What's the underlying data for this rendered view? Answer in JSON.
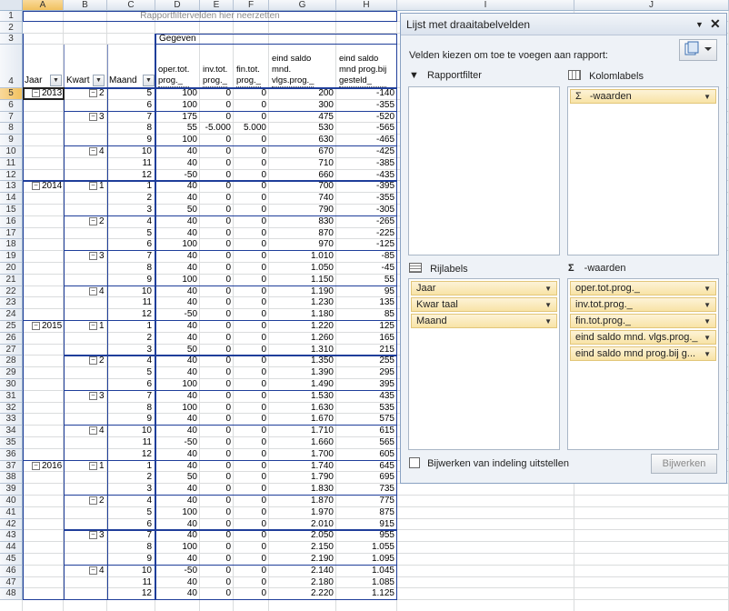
{
  "sheet": {
    "col_headers": [
      "A",
      "B",
      "C",
      "D",
      "E",
      "F",
      "G",
      "H",
      "I",
      "J"
    ],
    "row_numbers": [
      "1",
      "2",
      "3",
      "4",
      "5",
      "6",
      "7",
      "8",
      "9",
      "10",
      "11",
      "12",
      "13",
      "14",
      "15",
      "16",
      "17",
      "18",
      "19",
      "20",
      "21",
      "22",
      "23",
      "24",
      "25",
      "26",
      "27",
      "28",
      "29",
      "30",
      "31",
      "32",
      "33",
      "34",
      "35",
      "36",
      "37",
      "38",
      "39",
      "40",
      "41",
      "42",
      "43",
      "44",
      "45",
      "46",
      "47",
      "48"
    ],
    "report_filter_drop": "Rapportfiltervelden hier neerzetten",
    "data_label": "Gegeven",
    "row_field_headers": [
      "Jaar",
      "Kwart",
      "Maand"
    ],
    "value_headers": [
      "oper.tot.\nprog._",
      "inv.tot.\nprog._",
      "fin.tot.\nprog._",
      "eind saldo\nmnd.\nvlgs.prog._",
      "eind saldo\nmnd prog.bij\ngesteld_"
    ],
    "rows": [
      {
        "jaar": "2013",
        "kwart": "2",
        "maand": "5",
        "d": "100",
        "e": "0",
        "f": "0",
        "g": "200",
        "h": "-140"
      },
      {
        "jaar": "",
        "kwart": "",
        "maand": "6",
        "d": "100",
        "e": "0",
        "f": "0",
        "g": "300",
        "h": "-355"
      },
      {
        "jaar": "",
        "kwart": "3",
        "maand": "7",
        "d": "175",
        "e": "0",
        "f": "0",
        "g": "475",
        "h": "-520"
      },
      {
        "jaar": "",
        "kwart": "",
        "maand": "8",
        "d": "55",
        "e": "-5.000",
        "f": "5.000",
        "g": "530",
        "h": "-565"
      },
      {
        "jaar": "",
        "kwart": "",
        "maand": "9",
        "d": "100",
        "e": "0",
        "f": "0",
        "g": "630",
        "h": "-465"
      },
      {
        "jaar": "",
        "kwart": "4",
        "maand": "10",
        "d": "40",
        "e": "0",
        "f": "0",
        "g": "670",
        "h": "-425"
      },
      {
        "jaar": "",
        "kwart": "",
        "maand": "11",
        "d": "40",
        "e": "0",
        "f": "0",
        "g": "710",
        "h": "-385"
      },
      {
        "jaar": "",
        "kwart": "",
        "maand": "12",
        "d": "-50",
        "e": "0",
        "f": "0",
        "g": "660",
        "h": "-435"
      },
      {
        "jaar": "2014",
        "kwart": "1",
        "maand": "1",
        "d": "40",
        "e": "0",
        "f": "0",
        "g": "700",
        "h": "-395"
      },
      {
        "jaar": "",
        "kwart": "",
        "maand": "2",
        "d": "40",
        "e": "0",
        "f": "0",
        "g": "740",
        "h": "-355"
      },
      {
        "jaar": "",
        "kwart": "",
        "maand": "3",
        "d": "50",
        "e": "0",
        "f": "0",
        "g": "790",
        "h": "-305"
      },
      {
        "jaar": "",
        "kwart": "2",
        "maand": "4",
        "d": "40",
        "e": "0",
        "f": "0",
        "g": "830",
        "h": "-265"
      },
      {
        "jaar": "",
        "kwart": "",
        "maand": "5",
        "d": "40",
        "e": "0",
        "f": "0",
        "g": "870",
        "h": "-225"
      },
      {
        "jaar": "",
        "kwart": "",
        "maand": "6",
        "d": "100",
        "e": "0",
        "f": "0",
        "g": "970",
        "h": "-125"
      },
      {
        "jaar": "",
        "kwart": "3",
        "maand": "7",
        "d": "40",
        "e": "0",
        "f": "0",
        "g": "1.010",
        "h": "-85"
      },
      {
        "jaar": "",
        "kwart": "",
        "maand": "8",
        "d": "40",
        "e": "0",
        "f": "0",
        "g": "1.050",
        "h": "-45"
      },
      {
        "jaar": "",
        "kwart": "",
        "maand": "9",
        "d": "100",
        "e": "0",
        "f": "0",
        "g": "1.150",
        "h": "55"
      },
      {
        "jaar": "",
        "kwart": "4",
        "maand": "10",
        "d": "40",
        "e": "0",
        "f": "0",
        "g": "1.190",
        "h": "95"
      },
      {
        "jaar": "",
        "kwart": "",
        "maand": "11",
        "d": "40",
        "e": "0",
        "f": "0",
        "g": "1.230",
        "h": "135"
      },
      {
        "jaar": "",
        "kwart": "",
        "maand": "12",
        "d": "-50",
        "e": "0",
        "f": "0",
        "g": "1.180",
        "h": "85"
      },
      {
        "jaar": "2015",
        "kwart": "1",
        "maand": "1",
        "d": "40",
        "e": "0",
        "f": "0",
        "g": "1.220",
        "h": "125"
      },
      {
        "jaar": "",
        "kwart": "",
        "maand": "2",
        "d": "40",
        "e": "0",
        "f": "0",
        "g": "1.260",
        "h": "165"
      },
      {
        "jaar": "",
        "kwart": "",
        "maand": "3",
        "d": "50",
        "e": "0",
        "f": "0",
        "g": "1.310",
        "h": "215"
      },
      {
        "jaar": "",
        "kwart": "2",
        "maand": "4",
        "d": "40",
        "e": "0",
        "f": "0",
        "g": "1.350",
        "h": "255"
      },
      {
        "jaar": "",
        "kwart": "",
        "maand": "5",
        "d": "40",
        "e": "0",
        "f": "0",
        "g": "1.390",
        "h": "295"
      },
      {
        "jaar": "",
        "kwart": "",
        "maand": "6",
        "d": "100",
        "e": "0",
        "f": "0",
        "g": "1.490",
        "h": "395"
      },
      {
        "jaar": "",
        "kwart": "3",
        "maand": "7",
        "d": "40",
        "e": "0",
        "f": "0",
        "g": "1.530",
        "h": "435"
      },
      {
        "jaar": "",
        "kwart": "",
        "maand": "8",
        "d": "100",
        "e": "0",
        "f": "0",
        "g": "1.630",
        "h": "535"
      },
      {
        "jaar": "",
        "kwart": "",
        "maand": "9",
        "d": "40",
        "e": "0",
        "f": "0",
        "g": "1.670",
        "h": "575"
      },
      {
        "jaar": "",
        "kwart": "4",
        "maand": "10",
        "d": "40",
        "e": "0",
        "f": "0",
        "g": "1.710",
        "h": "615"
      },
      {
        "jaar": "",
        "kwart": "",
        "maand": "11",
        "d": "-50",
        "e": "0",
        "f": "0",
        "g": "1.660",
        "h": "565"
      },
      {
        "jaar": "",
        "kwart": "",
        "maand": "12",
        "d": "40",
        "e": "0",
        "f": "0",
        "g": "1.700",
        "h": "605"
      },
      {
        "jaar": "2016",
        "kwart": "1",
        "maand": "1",
        "d": "40",
        "e": "0",
        "f": "0",
        "g": "1.740",
        "h": "645"
      },
      {
        "jaar": "",
        "kwart": "",
        "maand": "2",
        "d": "50",
        "e": "0",
        "f": "0",
        "g": "1.790",
        "h": "695"
      },
      {
        "jaar": "",
        "kwart": "",
        "maand": "3",
        "d": "40",
        "e": "0",
        "f": "0",
        "g": "1.830",
        "h": "735"
      },
      {
        "jaar": "",
        "kwart": "2",
        "maand": "4",
        "d": "40",
        "e": "0",
        "f": "0",
        "g": "1.870",
        "h": "775"
      },
      {
        "jaar": "",
        "kwart": "",
        "maand": "5",
        "d": "100",
        "e": "0",
        "f": "0",
        "g": "1.970",
        "h": "875"
      },
      {
        "jaar": "",
        "kwart": "",
        "maand": "6",
        "d": "40",
        "e": "0",
        "f": "0",
        "g": "2.010",
        "h": "915"
      },
      {
        "jaar": "",
        "kwart": "3",
        "maand": "7",
        "d": "40",
        "e": "0",
        "f": "0",
        "g": "2.050",
        "h": "955"
      },
      {
        "jaar": "",
        "kwart": "",
        "maand": "8",
        "d": "100",
        "e": "0",
        "f": "0",
        "g": "2.150",
        "h": "1.055"
      },
      {
        "jaar": "",
        "kwart": "",
        "maand": "9",
        "d": "40",
        "e": "0",
        "f": "0",
        "g": "2.190",
        "h": "1.095"
      },
      {
        "jaar": "",
        "kwart": "4",
        "maand": "10",
        "d": "-50",
        "e": "0",
        "f": "0",
        "g": "2.140",
        "h": "1.045"
      },
      {
        "jaar": "",
        "kwart": "",
        "maand": "11",
        "d": "40",
        "e": "0",
        "f": "0",
        "g": "2.180",
        "h": "1.085"
      },
      {
        "jaar": "",
        "kwart": "",
        "maand": "12",
        "d": "40",
        "e": "0",
        "f": "0",
        "g": "2.220",
        "h": "1.125"
      }
    ]
  },
  "panel": {
    "title": "Lijst met draaitabelvelden",
    "instruction": "Velden kiezen om toe te voegen aan rapport:",
    "report_filter_label": "Rapportfilter",
    "column_labels_label": "Kolomlabels",
    "column_fields": [
      "-waarden"
    ],
    "row_labels_label": "Rijlabels",
    "row_fields": [
      "Jaar",
      "Kwar taal",
      "Maand"
    ],
    "values_label": "-waarden",
    "value_fields": [
      "oper.tot.prog._",
      "inv.tot.prog._",
      "fin.tot.prog._",
      "eind saldo mnd. vlgs.prog._",
      "eind saldo mnd prog.bij g..."
    ],
    "defer_label": "Bijwerken van indeling uitstellen",
    "update_button": "Bijwerken"
  }
}
